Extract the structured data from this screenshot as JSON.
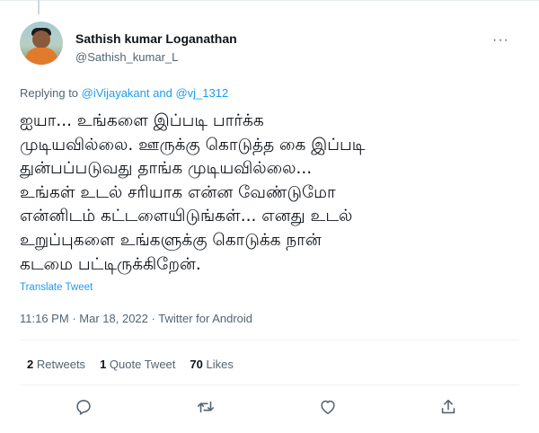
{
  "author": {
    "name": "Sathish kumar Loganathan",
    "handle": "@Sathish_kumar_L"
  },
  "more_label": "···",
  "reply_to": {
    "prefix": "Replying to",
    "user1": "@iVijayakant",
    "conj": "and",
    "user2": "@vj_1312"
  },
  "tweet": {
    "lines": [
      "ஐயா... உங்களை இப்படி பார்க்க",
      "முடியவில்லை. ஊருக்கு கொடுத்த கை இப்படி",
      "துன்பப்படுவது தாங்க முடியவில்லை...",
      "உங்கள் உடல் சரியாக என்ன வேண்டுமோ",
      "என்னிடம் கட்டளையிடுங்கள்... எனது உடல்",
      "உறுப்புகளை உங்களுக்கு கொடுக்க நான்",
      "கடமை பட்டிருக்கிறேன்."
    ]
  },
  "translate_label": "Translate Tweet",
  "meta": {
    "time": "11:16 PM",
    "dot": "·",
    "date": "Mar 18, 2022",
    "source": "Twitter for Android"
  },
  "stats": {
    "retweets_count": "2",
    "retweets_label": "Retweets",
    "quotes_count": "1",
    "quotes_label": "Quote Tweet",
    "likes_count": "70",
    "likes_label": "Likes"
  },
  "actions": {
    "icons": [
      "reply-icon",
      "retweet-icon",
      "like-icon",
      "share-icon"
    ]
  },
  "colors": {
    "accent": "#1d9bf0",
    "text": "#0f1419",
    "secondary": "#536471",
    "divider": "#eff3f4"
  }
}
